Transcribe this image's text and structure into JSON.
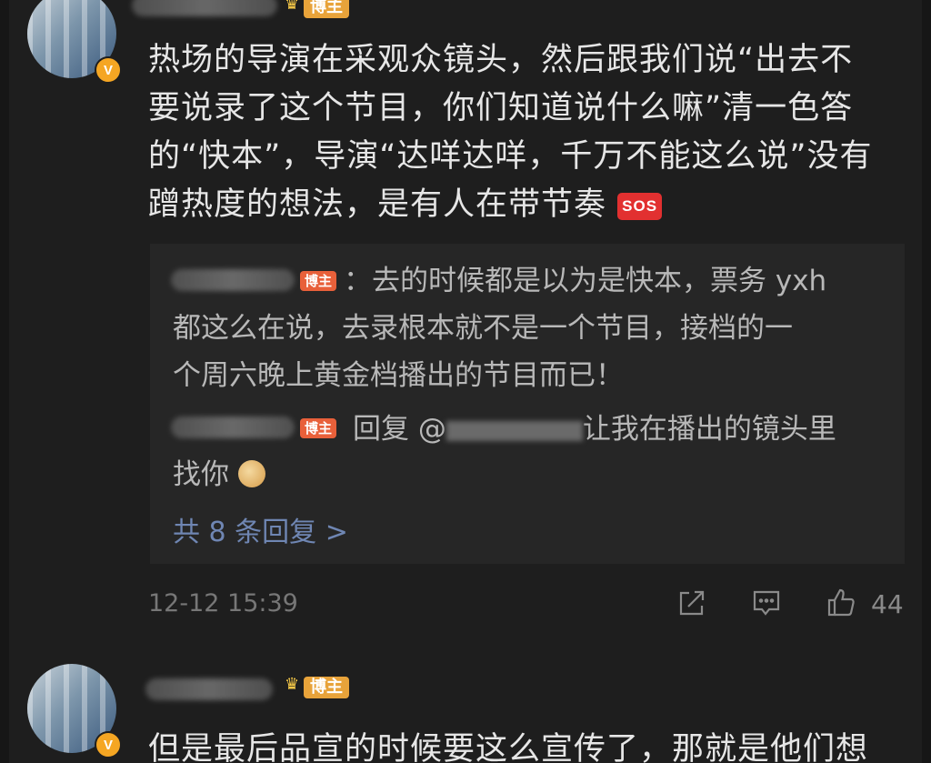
{
  "comment1": {
    "badge_label": "博主",
    "verified_mark": "V",
    "text_lines": [
      "热场的导演在采观众镜头，然后跟我们说“出去不",
      "要说录了这个节目，你们知道说什么嘛”清一色答",
      "的“快本”，导演“达咩达咩，千万不能这么说”没有",
      "蹭热度的想法，是有人在带节奏"
    ],
    "emoji_sos": "SOS",
    "time": "12-12 15:39",
    "like_count": "44",
    "icons": [
      "share-icon",
      "comment-icon",
      "like-icon"
    ]
  },
  "replies": {
    "reply1": {
      "badge_label": "博主",
      "lines": [
        "：去的时候都是以为是快本，票务 yxh",
        "都这么在说，去录根本就不是一个节目，接档的一",
        "个周六晚上黄金档播出的节目而已！"
      ]
    },
    "reply2": {
      "badge_label": "博主",
      "line1_prefix": "回复 @",
      "line1_suffix": "让我在播出的镜头里",
      "line2": "找你"
    },
    "more_label": "共 8 条回复 >"
  },
  "comment2": {
    "badge_label": "博主",
    "text": "但是最后品宣的时候要这么宣传了，那就是他们想"
  },
  "colors": {
    "background": "#1e1e1e",
    "reply_box": "#262626",
    "link": "#6f86b3",
    "badge": "#e8a33a"
  }
}
